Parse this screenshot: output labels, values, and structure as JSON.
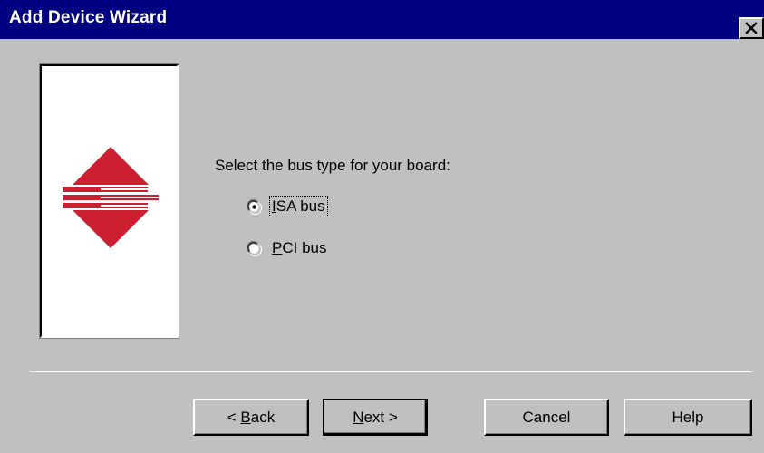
{
  "window": {
    "title": "Add Device Wizard",
    "close_symbol": "×"
  },
  "wizard": {
    "prompt": "Select the bus type for your board:",
    "options": [
      {
        "pre": "",
        "accel": "I",
        "rest": "SA bus",
        "selected": true
      },
      {
        "pre": "",
        "accel": "P",
        "rest": "CI bus",
        "selected": false
      }
    ]
  },
  "buttons": {
    "back": {
      "pre": "< ",
      "accel": "B",
      "rest": "ack"
    },
    "next": {
      "pre": "",
      "accel": "N",
      "rest": "ext >"
    },
    "cancel": "Cancel",
    "help": "Help"
  },
  "colors": {
    "title_bar": "#000080",
    "face": "#c0c0c0",
    "logo_red": "#cc2030"
  },
  "icons": {
    "wizard_logo": "bus-arrows-icon",
    "close": "close-icon"
  }
}
